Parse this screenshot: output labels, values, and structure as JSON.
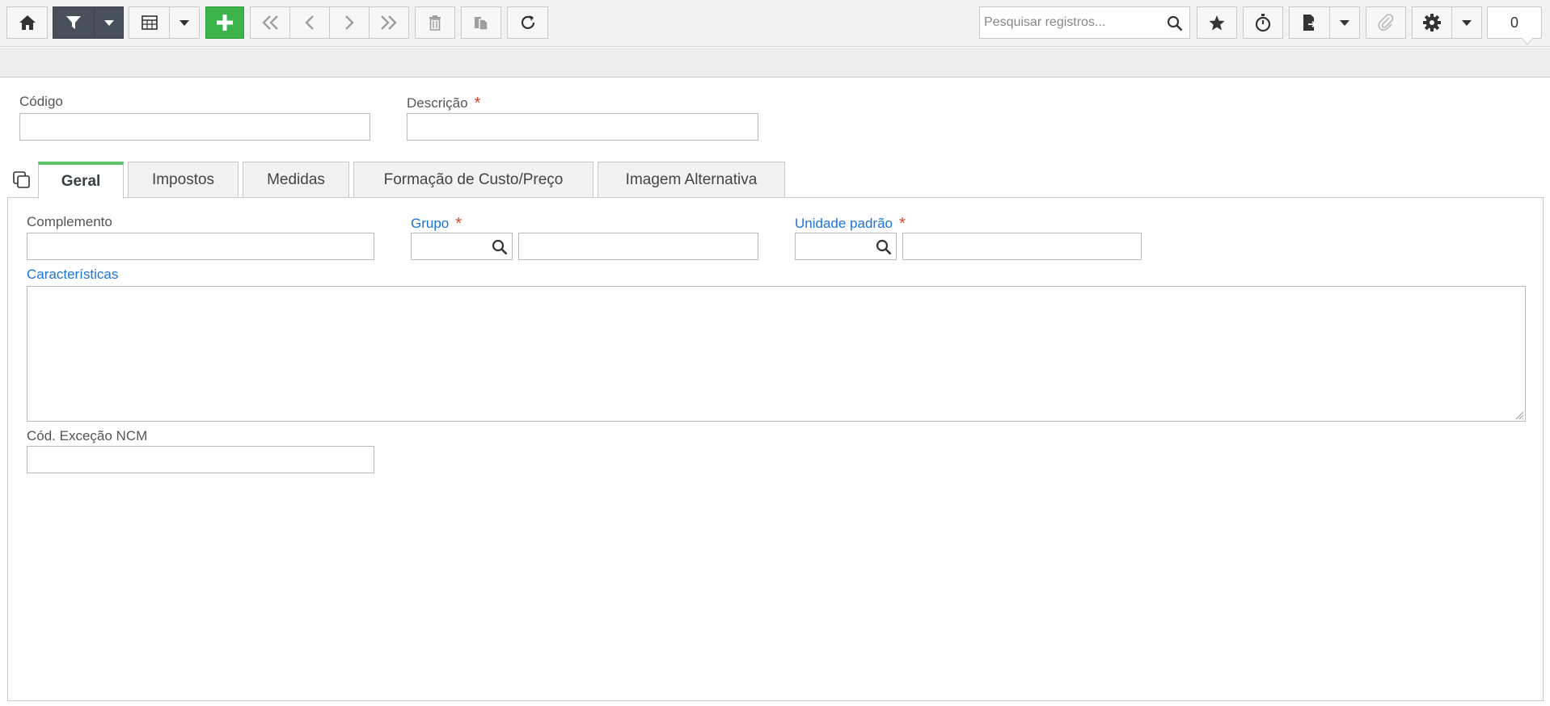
{
  "toolbar": {
    "search_placeholder": "Pesquisar registros...",
    "record_count": "0"
  },
  "form": {
    "codigo_label": "Código",
    "descricao_label": "Descrição",
    "required_marker": "*"
  },
  "tabs": [
    {
      "label": "Geral",
      "active": true
    },
    {
      "label": "Impostos",
      "active": false
    },
    {
      "label": "Medidas",
      "active": false
    },
    {
      "label": "Formação de Custo/Preço",
      "active": false
    },
    {
      "label": "Imagem Alternativa",
      "active": false
    }
  ],
  "geral": {
    "complemento_label": "Complemento",
    "grupo_label": "Grupo",
    "unidade_label": "Unidade padrão",
    "caracteristicas_label": "Características",
    "cod_excecao_label": "Cód. Exceção NCM"
  },
  "colors": {
    "accent_green": "#3cb44b",
    "dark_button": "#48505c",
    "link_blue": "#1a73d9",
    "required_red": "#d9432b",
    "active_tab_bar": "#5cc36a"
  },
  "icons": [
    "home-icon",
    "filter-icon",
    "caret-down-icon",
    "table-icon",
    "plus-icon",
    "first-record-icon",
    "previous-record-icon",
    "next-record-icon",
    "last-record-icon",
    "trash-icon",
    "duplicate-icon",
    "refresh-icon",
    "search-icon",
    "star-icon",
    "timer-icon",
    "export-icon",
    "paperclip-icon",
    "gear-icon",
    "copy-icon"
  ]
}
